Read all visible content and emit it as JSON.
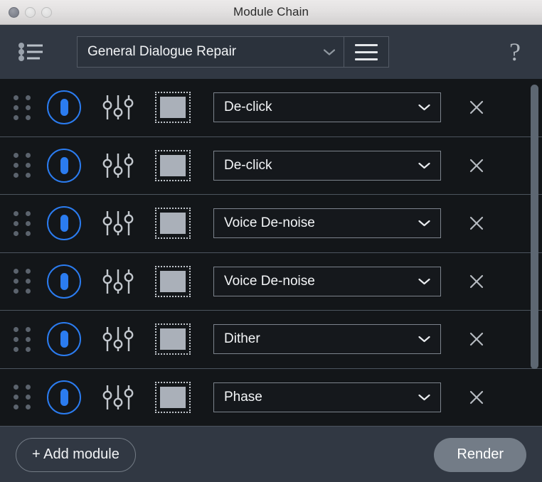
{
  "window": {
    "title": "Module Chain",
    "traffic_lights": [
      {
        "name": "close",
        "icon": "close-circle-icon"
      },
      {
        "name": "minimize",
        "icon": "minimize-circle-icon"
      },
      {
        "name": "maximize",
        "icon": "maximize-circle-icon"
      }
    ]
  },
  "toolbar": {
    "chain_icon": "chain-list-icon",
    "preset": {
      "value": "General Dialogue Repair",
      "chevron_icon": "chevron-down-icon"
    },
    "menu_icon": "hamburger-menu-icon",
    "help_label": "?",
    "help_icon": "question-mark-icon"
  },
  "modules": {
    "row_icons": {
      "drag": "drag-handle-dots-icon",
      "power": "power-toggle-icon",
      "settings": "sliders-icon",
      "region": "selection-region-icon",
      "chevron": "chevron-down-icon",
      "remove": "close-x-icon"
    },
    "rows": [
      {
        "name": "De-click",
        "enabled": true
      },
      {
        "name": "De-click",
        "enabled": true
      },
      {
        "name": "Voice De-noise",
        "enabled": true
      },
      {
        "name": "Voice De-noise",
        "enabled": true
      },
      {
        "name": "Dither",
        "enabled": true
      },
      {
        "name": "Phase",
        "enabled": true
      }
    ]
  },
  "footer": {
    "add_label": "+ Add module",
    "render_label": "Render"
  },
  "colors": {
    "accent_blue": "#2b7cf0",
    "toolbar_bg": "#313843",
    "list_bg": "#131619",
    "render_bg": "#737c87"
  }
}
